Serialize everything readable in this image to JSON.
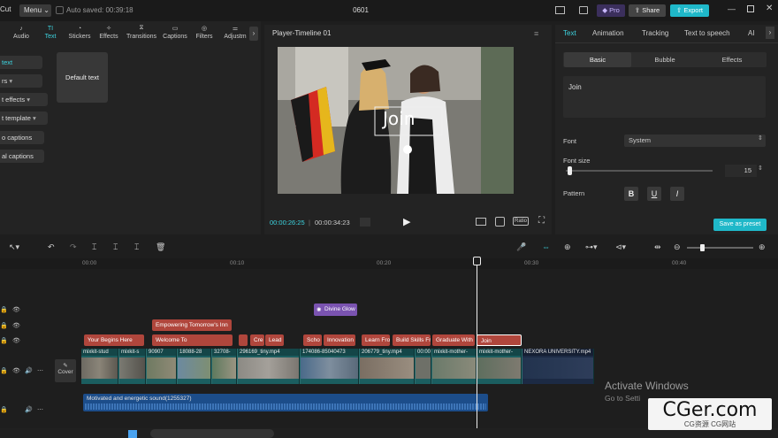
{
  "window": {
    "app_logo": "Cut",
    "menu_label": "Menu",
    "autosave": "Auto saved: 00:39:18",
    "project_title": "0601",
    "pro_label": "Pro",
    "share_label": "Share",
    "export_label": "Export"
  },
  "toolbar": {
    "items": [
      {
        "label": "Audio",
        "icon": "music-note-icon"
      },
      {
        "label": "Text",
        "icon": "text-icon"
      },
      {
        "label": "Stickers",
        "icon": "sticker-icon"
      },
      {
        "label": "Effects",
        "icon": "sparkle-icon"
      },
      {
        "label": "Transitions",
        "icon": "transition-icon"
      },
      {
        "label": "Captions",
        "icon": "captions-icon"
      },
      {
        "label": "Filters",
        "icon": "filter-icon"
      },
      {
        "label": "Adjustm",
        "icon": "adjust-icon"
      }
    ]
  },
  "left_panel": {
    "items": [
      "text",
      "rs",
      "t effects",
      "t template",
      "o captions",
      "al captions"
    ],
    "default_text_card": "Default text"
  },
  "player": {
    "title": "Player-Timeline 01",
    "overlay_text": "Join",
    "current_time": "00:00:26:25",
    "total_time": "00:00:34:23",
    "ratio_label": "Ratio"
  },
  "inspector": {
    "tabs": [
      "Text",
      "Animation",
      "Tracking",
      "Text to speech",
      "AI"
    ],
    "subtabs": [
      "Basic",
      "Bubble",
      "Effects"
    ],
    "text_value": "Join",
    "font_label": "Font",
    "font_value": "System",
    "font_size_label": "Font size",
    "font_size_value": "15",
    "pattern_label": "Pattern",
    "bold": "B",
    "underline": "U",
    "italic": "I",
    "save_preset": "Save as preset"
  },
  "timeline": {
    "ticks": [
      "00:00",
      "00:10",
      "00:20",
      "00:30",
      "00:40"
    ],
    "effect_clip": "Divine Glow",
    "text_row1": [
      "Empowering Tomorrow's Inn"
    ],
    "text_row2": [
      "Your Begins Here",
      "Welcome To",
      "Cre",
      "Lead",
      "Scho",
      "Innovation",
      "Learn Fro",
      "Build Skills Fr",
      "Graduate With",
      "Join"
    ],
    "video_clips": [
      "mixkit-stud",
      "mixkit-s",
      "90907",
      "18088-28",
      "32708-",
      "296169_tiny.mp4",
      "174086-85040473",
      "206779_tiny.mp4",
      "00:00",
      "mixkit-mother-",
      "mixkit-mother-",
      "NEXORA UNIVERSITY.mp4"
    ],
    "audio_clip": "Motivated and energetic sound(1255327)",
    "cover_label": "Cover"
  },
  "overlay": {
    "activate_title": "Activate Windows",
    "activate_sub": "Go to Setti",
    "cger_title": "CGer.com",
    "cger_sub": "CG资源 CG网站"
  },
  "colors": {
    "accent": "#3dd4e0",
    "text_clip": "#b0463c",
    "effect_clip": "#7a53b0",
    "audio_clip": "#1c4d8a",
    "video_track": "#1b5e60"
  }
}
